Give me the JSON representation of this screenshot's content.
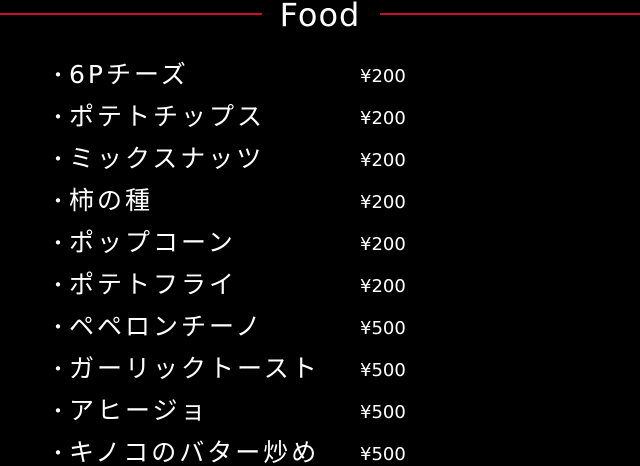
{
  "header": {
    "title": "Food",
    "accent_color": "#c8102e"
  },
  "menu": {
    "bullet": "・",
    "items": [
      {
        "name": "6Pチーズ",
        "price": "¥200"
      },
      {
        "name": "ポテトチップス",
        "price": "¥200"
      },
      {
        "name": "ミックスナッツ",
        "price": "¥200"
      },
      {
        "name": "柿の種",
        "price": "¥200"
      },
      {
        "name": "ポップコーン",
        "price": "¥200"
      },
      {
        "name": "ポテトフライ",
        "price": "¥200"
      },
      {
        "name": "ペペロンチーノ",
        "price": "¥500"
      },
      {
        "name": "ガーリックトースト",
        "price": "¥500"
      },
      {
        "name": "アヒージョ",
        "price": "¥500"
      },
      {
        "name": "キノコのバター炒め",
        "price": "¥500"
      }
    ]
  }
}
